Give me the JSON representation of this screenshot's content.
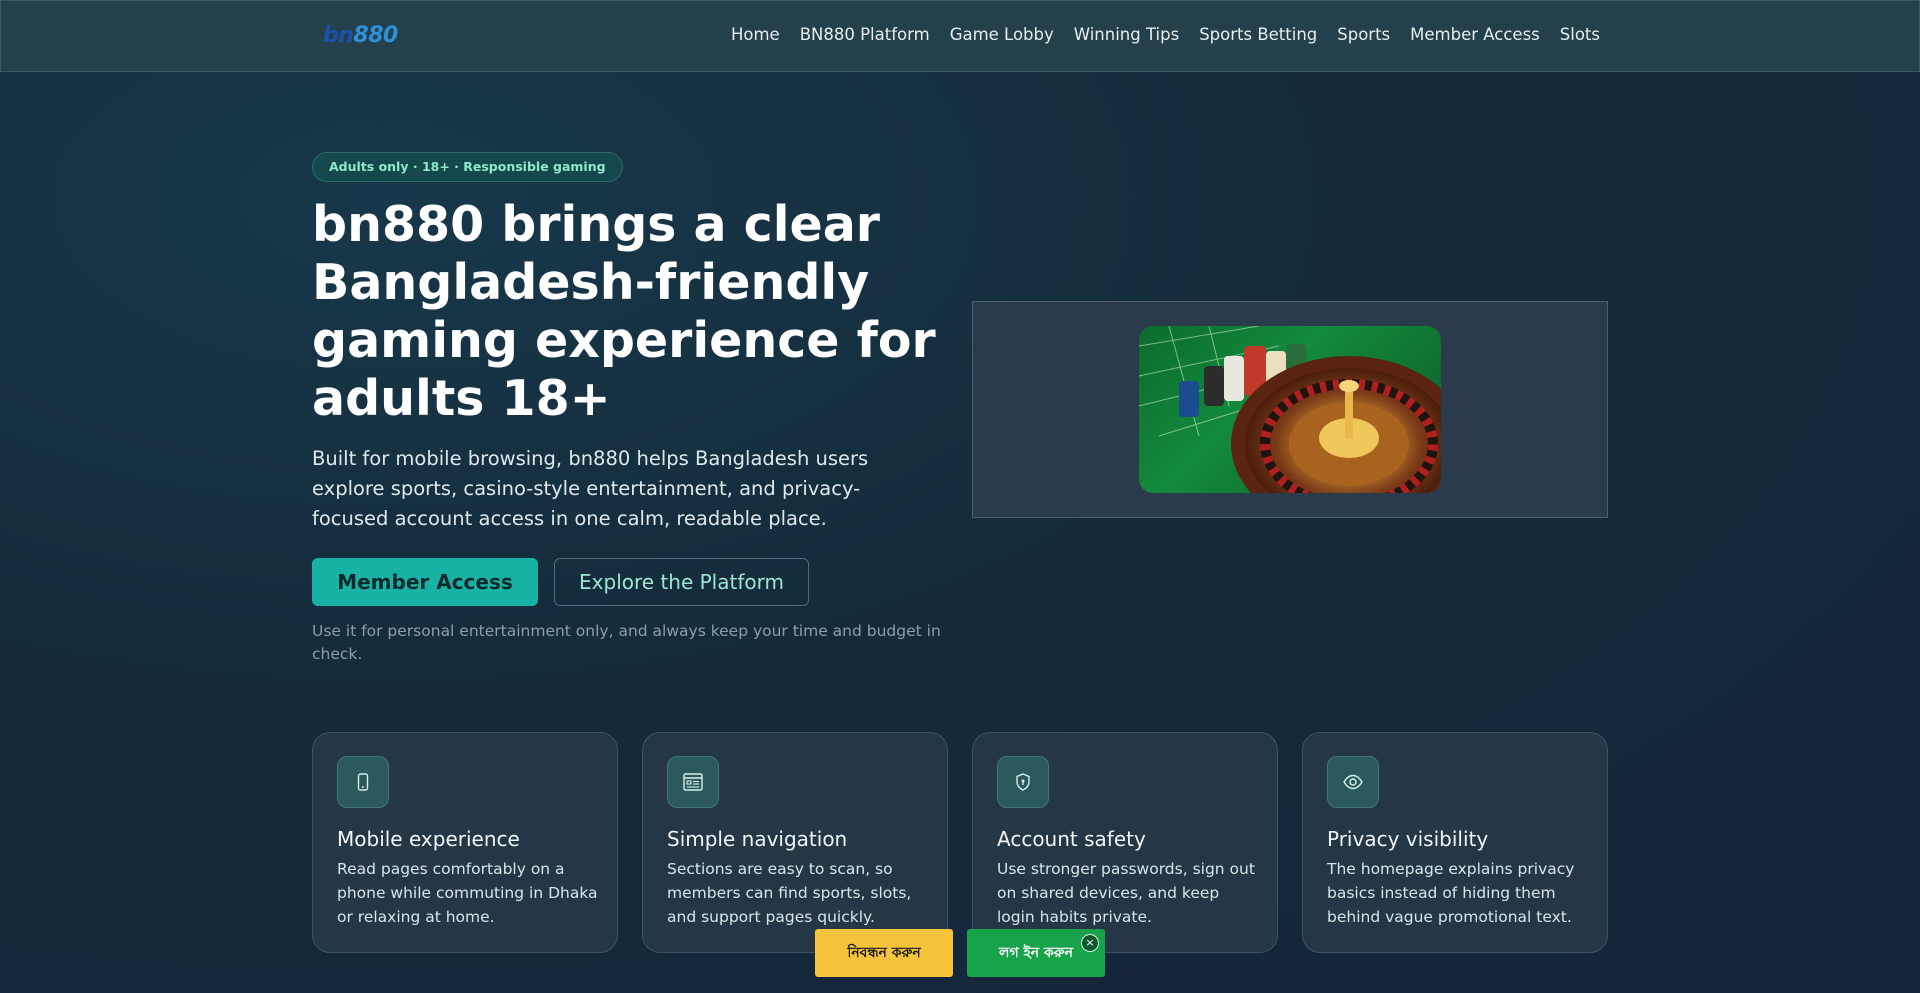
{
  "header": {
    "logo_part1": "bn",
    "logo_part2": "880",
    "nav": [
      "Home",
      "BN880 Platform",
      "Game Lobby",
      "Winning Tips",
      "Sports Betting",
      "Sports",
      "Member Access",
      "Slots"
    ]
  },
  "hero": {
    "badge": "Adults only · 18+ · Responsible gaming",
    "title": "bn880 brings a clear Bangladesh-friendly gaming experience for adults 18+",
    "subtitle": "Built for mobile browsing, bn880 helps Bangladesh users explore sports, casino-style entertainment, and privacy-focused account access in one calm, readable place.",
    "primary_button": "Member Access",
    "secondary_button": "Explore the Platform",
    "note": "Use it for personal entertainment only, and always keep your time and budget in check."
  },
  "features": [
    {
      "icon": "mobile-icon",
      "title": "Mobile experience",
      "desc": "Read pages comfortably on a phone while commuting in Dhaka or relaxing at home."
    },
    {
      "icon": "list-icon",
      "title": "Simple navigation",
      "desc": "Sections are easy to scan, so members can find sports, slots, and support pages quickly."
    },
    {
      "icon": "shield-icon",
      "title": "Account safety",
      "desc": "Use stronger passwords, sign out on shared devices, and keep login habits private."
    },
    {
      "icon": "eye-icon",
      "title": "Privacy visibility",
      "desc": "The homepage explains privacy basics instead of hiding them behind vague promotional text."
    }
  ],
  "floating": {
    "register": "নিবন্ধন করুন",
    "login": "লগ ইন করুন",
    "close": "×"
  },
  "colors": {
    "accent": "#19b3a5",
    "register_bg": "#f5c43a",
    "login_bg": "#17a34a"
  }
}
